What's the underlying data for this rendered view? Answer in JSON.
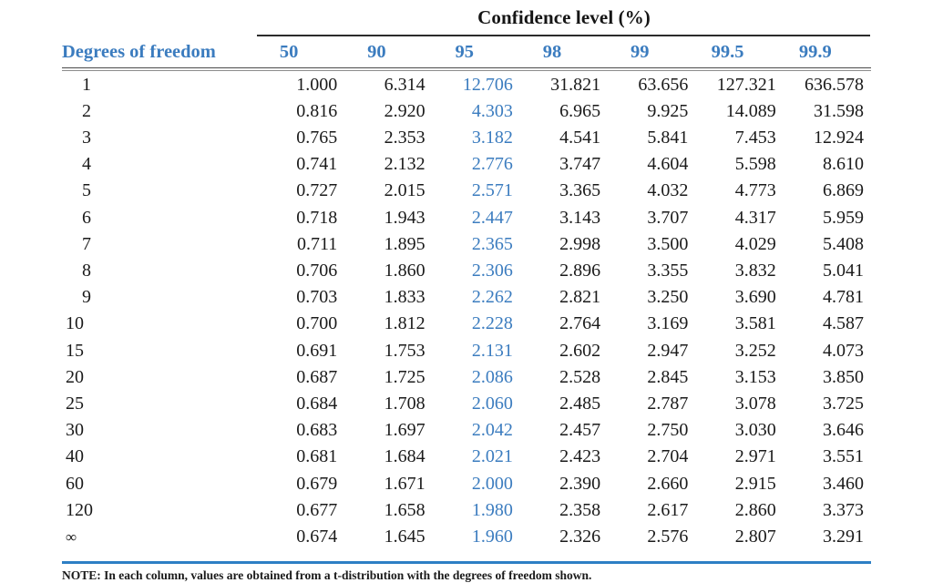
{
  "table": {
    "spanner_label": "Confidence level (%)",
    "dof_header": "Degrees of freedom",
    "column_headers": [
      "50",
      "90",
      "95",
      "98",
      "99",
      "99.5",
      "99.9"
    ],
    "accent_column_index": 2,
    "accent_color": "#3b7cbf",
    "rule_color": "#2d7fc4",
    "note": "NOTE: In each column, values are obtained from a t-distribution with the degrees of freedom shown.",
    "rows": [
      {
        "dof": "1",
        "values": [
          "1.000",
          "6.314",
          "12.706",
          "31.821",
          "63.656",
          "127.321",
          "636.578"
        ]
      },
      {
        "dof": "2",
        "values": [
          "0.816",
          "2.920",
          "4.303",
          "6.965",
          "9.925",
          "14.089",
          "31.598"
        ]
      },
      {
        "dof": "3",
        "values": [
          "0.765",
          "2.353",
          "3.182",
          "4.541",
          "5.841",
          "7.453",
          "12.924"
        ]
      },
      {
        "dof": "4",
        "values": [
          "0.741",
          "2.132",
          "2.776",
          "3.747",
          "4.604",
          "5.598",
          "8.610"
        ]
      },
      {
        "dof": "5",
        "values": [
          "0.727",
          "2.015",
          "2.571",
          "3.365",
          "4.032",
          "4.773",
          "6.869"
        ]
      },
      {
        "dof": "6",
        "values": [
          "0.718",
          "1.943",
          "2.447",
          "3.143",
          "3.707",
          "4.317",
          "5.959"
        ]
      },
      {
        "dof": "7",
        "values": [
          "0.711",
          "1.895",
          "2.365",
          "2.998",
          "3.500",
          "4.029",
          "5.408"
        ]
      },
      {
        "dof": "8",
        "values": [
          "0.706",
          "1.860",
          "2.306",
          "2.896",
          "3.355",
          "3.832",
          "5.041"
        ]
      },
      {
        "dof": "9",
        "values": [
          "0.703",
          "1.833",
          "2.262",
          "2.821",
          "3.250",
          "3.690",
          "4.781"
        ]
      },
      {
        "dof": "10",
        "values": [
          "0.700",
          "1.812",
          "2.228",
          "2.764",
          "3.169",
          "3.581",
          "4.587"
        ]
      },
      {
        "dof": "15",
        "values": [
          "0.691",
          "1.753",
          "2.131",
          "2.602",
          "2.947",
          "3.252",
          "4.073"
        ]
      },
      {
        "dof": "20",
        "values": [
          "0.687",
          "1.725",
          "2.086",
          "2.528",
          "2.845",
          "3.153",
          "3.850"
        ]
      },
      {
        "dof": "25",
        "values": [
          "0.684",
          "1.708",
          "2.060",
          "2.485",
          "2.787",
          "3.078",
          "3.725"
        ]
      },
      {
        "dof": "30",
        "values": [
          "0.683",
          "1.697",
          "2.042",
          "2.457",
          "2.750",
          "3.030",
          "3.646"
        ]
      },
      {
        "dof": "40",
        "values": [
          "0.681",
          "1.684",
          "2.021",
          "2.423",
          "2.704",
          "2.971",
          "3.551"
        ]
      },
      {
        "dof": "60",
        "values": [
          "0.679",
          "1.671",
          "2.000",
          "2.390",
          "2.660",
          "2.915",
          "3.460"
        ]
      },
      {
        "dof": "120",
        "values": [
          "0.677",
          "1.658",
          "1.980",
          "2.358",
          "2.617",
          "2.860",
          "3.373"
        ]
      },
      {
        "dof": "∞",
        "values": [
          "0.674",
          "1.645",
          "1.960",
          "2.326",
          "2.576",
          "2.807",
          "3.291"
        ]
      }
    ]
  }
}
